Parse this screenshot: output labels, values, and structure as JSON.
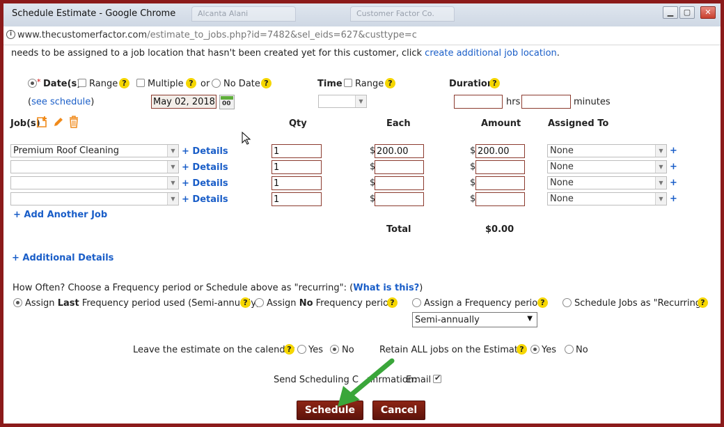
{
  "browser": {
    "title": "Schedule Estimate - Google Chrome",
    "url_host": "www.thecustomerfactor.com",
    "url_rest": "/estimate_to_jobs.php?id=7482&sel_eids=627&custtype=c",
    "ghost_tabs": [
      "Alcanta Alani",
      "Customer Factor Co."
    ]
  },
  "notice": {
    "text": "needs to be assigned to a job location that hasn't been created yet for this customer, click ",
    "link": "create additional job location",
    "end": "."
  },
  "date_section": {
    "dates_label": "Date(s)",
    "range_label": "Range",
    "multiple_label": "Multiple",
    "or_label": "or",
    "no_date_label": "No Date",
    "see_schedule_open": "(",
    "see_schedule": "see schedule",
    "see_schedule_close": ")",
    "date_value": "May 02, 2018",
    "calendar_num": "00",
    "time_label": "Time",
    "time_range_label": "Range",
    "duration_label": "Duration",
    "hrs_label": "hrs",
    "minutes_label": "minutes"
  },
  "jobs_table": {
    "jobs_label": "Job(s)",
    "headers": {
      "qty": "Qty",
      "each": "Each",
      "amount": "Amount",
      "assigned_to": "Assigned To"
    },
    "details_label": "+ Details",
    "rows": [
      {
        "job": "Premium Roof Cleaning",
        "qty": "1",
        "each": "200.00",
        "amount": "200.00",
        "assigned": "None"
      },
      {
        "job": "",
        "qty": "1",
        "each": "",
        "amount": "",
        "assigned": "None"
      },
      {
        "job": "",
        "qty": "1",
        "each": "",
        "amount": "",
        "assigned": "None"
      },
      {
        "job": "",
        "qty": "1",
        "each": "",
        "amount": "",
        "assigned": "None"
      }
    ],
    "currency": "$",
    "add_plus": "+",
    "add_another": "+ Add Another Job",
    "total_label": "Total",
    "total_value": "$0.00",
    "additional_details": "+ Additional Details"
  },
  "frequency": {
    "question": "How Often? Choose a Frequency period or Schedule above as \"recurring\": (",
    "what_is_this": "What is this?",
    "question_close": ")",
    "opt_last_pre": "Assign ",
    "opt_last_bold": "Last",
    "opt_last_post": " Frequency period used (Semi-annually)",
    "opt_no_pre": "Assign ",
    "opt_no_bold": "No",
    "opt_no_post": " Frequency period",
    "opt_assign": "Assign a Frequency period",
    "opt_recurring": "Schedule Jobs as \"Recurring\"",
    "period_value": "Semi-annually"
  },
  "options": {
    "leave_label": "Leave the estimate on the calendar",
    "yes": "Yes",
    "no": "No",
    "retain_label": "Retain ALL jobs on the Estimate",
    "send_label_a": "Send Scheduling C",
    "send_label_b": "nfirmation:",
    "email_label": "Email"
  },
  "buttons": {
    "schedule": "Schedule",
    "cancel": "Cancel"
  },
  "colors": {
    "frame": "#8b1a1a",
    "link": "#1a5ec8",
    "button": "#7a1c10",
    "help": "#f5d600",
    "arrow": "#3aa63a"
  }
}
